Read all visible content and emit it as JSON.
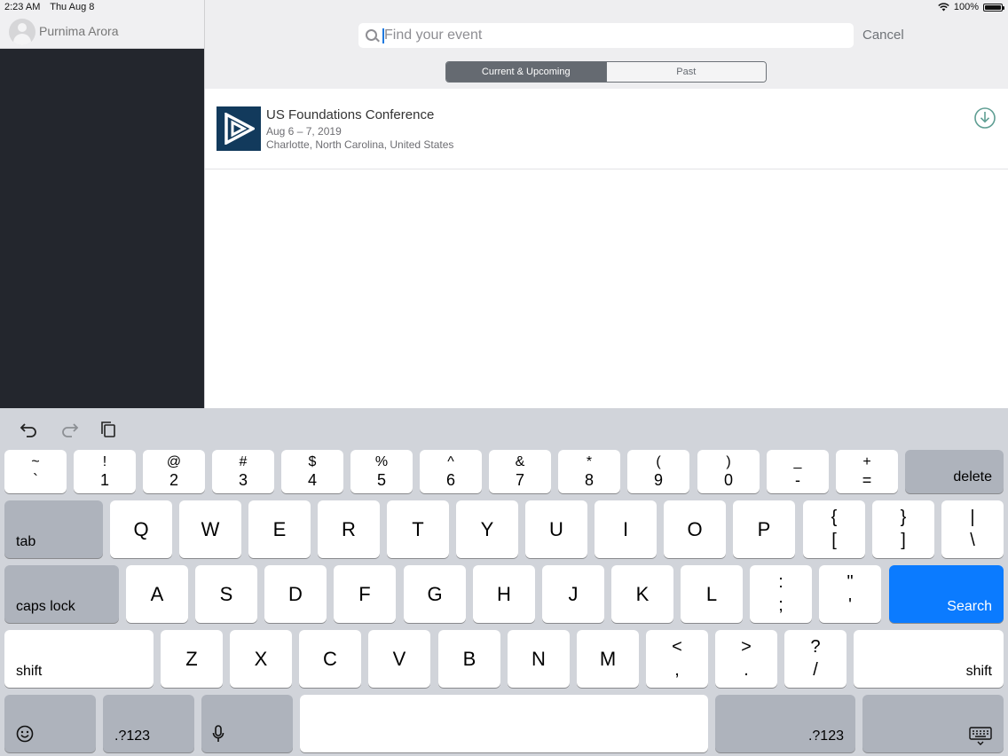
{
  "status": {
    "time": "2:23 AM",
    "date": "Thu Aug 8",
    "battery": "100%",
    "battery_level": 1.0
  },
  "sidebar": {
    "user_name": "Purnima Arora"
  },
  "search": {
    "placeholder": "Find your event",
    "value": "",
    "cancel": "Cancel"
  },
  "tabs": {
    "current": "Current & Upcoming",
    "past": "Past",
    "selected": "current"
  },
  "events": [
    {
      "title": "US Foundations Conference",
      "date": "Aug 6 – 7, 2019",
      "location": "Charlotte, North Carolina, United States"
    }
  ],
  "colors": {
    "accent": "#0b7bff",
    "segment": "#656a71",
    "sidebar": "#23262d",
    "download": "#5f9e93",
    "logo_bg": "#123a5c"
  },
  "keyboard": {
    "row1": [
      {
        "top": "~",
        "bottom": "`"
      },
      {
        "top": "!",
        "bottom": "1"
      },
      {
        "top": "@",
        "bottom": "2"
      },
      {
        "top": "#",
        "bottom": "3"
      },
      {
        "top": "$",
        "bottom": "4"
      },
      {
        "top": "%",
        "bottom": "5"
      },
      {
        "top": "^",
        "bottom": "6"
      },
      {
        "top": "&",
        "bottom": "7"
      },
      {
        "top": "*",
        "bottom": "8"
      },
      {
        "top": "(",
        "bottom": "9"
      },
      {
        "top": ")",
        "bottom": "0"
      },
      {
        "top": "_",
        "bottom": "-"
      },
      {
        "top": "+",
        "bottom": "="
      }
    ],
    "delete": "delete",
    "tab": "tab",
    "row2": [
      "Q",
      "W",
      "E",
      "R",
      "T",
      "Y",
      "U",
      "I",
      "O",
      "P"
    ],
    "row2_sym": [
      {
        "top": "{",
        "bottom": "["
      },
      {
        "top": "}",
        "bottom": "]"
      },
      {
        "top": "|",
        "bottom": "\\"
      }
    ],
    "caps": "caps lock",
    "row3": [
      "A",
      "S",
      "D",
      "F",
      "G",
      "H",
      "J",
      "K",
      "L"
    ],
    "row3_sym": [
      {
        "top": ":",
        "bottom": ";"
      },
      {
        "top": "\"",
        "bottom": "'"
      }
    ],
    "search": "Search",
    "shift": "shift",
    "row4": [
      "Z",
      "X",
      "C",
      "V",
      "B",
      "N",
      "M"
    ],
    "row4_sym": [
      {
        "top": "<",
        "bottom": ","
      },
      {
        "top": ">",
        "bottom": "."
      },
      {
        "top": "?",
        "bottom": "/"
      }
    ],
    "numbers": ".?123",
    "icons": {
      "emoji": "emoji-icon",
      "mic": "microphone-icon",
      "dismiss": "keyboard-dismiss-icon",
      "undo": "undo-icon",
      "redo": "redo-icon",
      "paste": "paste-icon"
    }
  }
}
